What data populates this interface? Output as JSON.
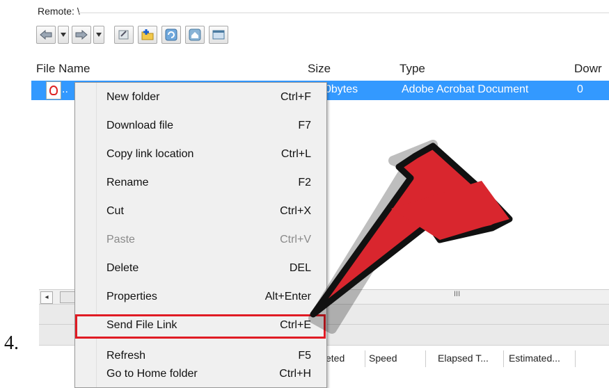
{
  "step_number": "4.",
  "window": {
    "remote_label": "Remote:",
    "remote_path": "\\"
  },
  "toolbar": {
    "buttons": [
      "back-arrow-icon",
      "dropdown-icon",
      "forward-arrow-icon",
      "dropdown-icon",
      "edit-icon",
      "new-folder-icon",
      "refresh-icon",
      "home-folder-icon",
      "window-icon"
    ]
  },
  "file_list": {
    "columns": [
      "File Name",
      "Size",
      "Type",
      "Dowr"
    ],
    "selected_row": {
      "name": "..",
      "size": "0bytes",
      "type": "Adobe Acrobat Document",
      "downloads": "0"
    }
  },
  "context_menu": {
    "items": [
      {
        "label": "New folder",
        "shortcut": "Ctrl+F"
      },
      {
        "label": "Download file",
        "shortcut": "F7"
      },
      {
        "label": "Copy link location",
        "shortcut": "Ctrl+L"
      },
      {
        "label": "Rename",
        "shortcut": "F2"
      },
      {
        "label": "Cut",
        "shortcut": "Ctrl+X"
      },
      {
        "label": "Paste",
        "shortcut": "Ctrl+V",
        "disabled": true
      },
      {
        "label": "Delete",
        "shortcut": "DEL"
      },
      {
        "label": "Properties",
        "shortcut": "Alt+Enter"
      },
      {
        "label": "Send File Link",
        "shortcut": "Ctrl+E",
        "highlighted": true
      },
      {
        "label": "Refresh",
        "shortcut": "F5"
      },
      {
        "label": "Go to Home folder",
        "shortcut": "Ctrl+H"
      }
    ]
  },
  "scrollbar": {
    "grip": "III"
  },
  "queue_columns": [
    "eted",
    "Speed",
    "Elapsed T...",
    "Estimated..."
  ],
  "colors": {
    "selection": "#3399ff",
    "highlight_border": "#e01b24",
    "arrow_fill": "#d9262e",
    "arrow_outline": "#111111"
  }
}
